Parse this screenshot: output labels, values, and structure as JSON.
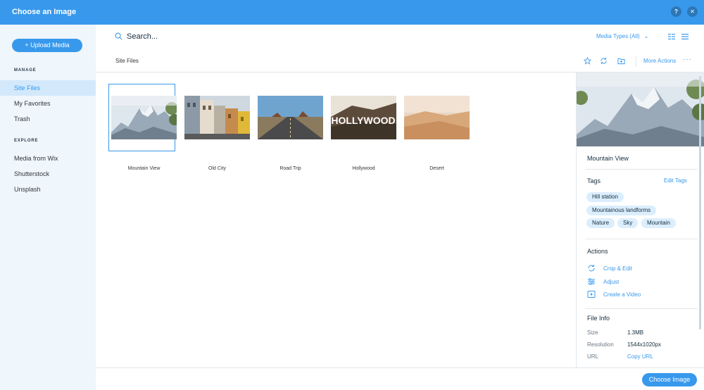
{
  "window": {
    "title": "Choose an Image",
    "help_label": "?",
    "close_label": "✕"
  },
  "sidebar": {
    "upload_label": "+ Upload Media",
    "manage_heading": "MANAGE",
    "manage_items": [
      {
        "label": "Site Files",
        "active": true
      },
      {
        "label": "My Favorites"
      },
      {
        "label": "Trash"
      }
    ],
    "explore_heading": "EXPLORE",
    "explore_items": [
      {
        "label": "Media from Wix"
      },
      {
        "label": "Shutterstock"
      },
      {
        "label": "Unsplash"
      }
    ]
  },
  "search": {
    "text": "Search...",
    "icon": "search-icon"
  },
  "filters": {
    "media_types": "Media Types (All)",
    "chevron": "⌄"
  },
  "toolbar": {
    "breadcrumb": "Site Files",
    "more_actions": "More Actions",
    "more_dots": "···"
  },
  "grid": {
    "items": [
      {
        "caption": "Mountain View",
        "selected": true
      },
      {
        "caption": "Old City"
      },
      {
        "caption": "Road Trip"
      },
      {
        "caption": "Hollywood"
      },
      {
        "caption": "Desert"
      }
    ],
    "hollywood_sign_text": "HOLLYWOOD"
  },
  "details": {
    "name": "Mountain View",
    "tags_title": "Tags",
    "edit_tags": "Edit Tags",
    "tags": [
      "Hill station",
      "Mountainous landforms",
      "Nature",
      "Sky",
      "Mountain"
    ],
    "actions_title": "Actions",
    "actions": [
      {
        "label": "Crop & Edit",
        "icon": "crop-icon"
      },
      {
        "label": "Adjust",
        "icon": "adjust-icon"
      },
      {
        "label": "Create a Video",
        "icon": "video-icon"
      }
    ],
    "file_info_title": "File Info",
    "file_info": [
      {
        "key": "Size",
        "value": "1.3MB"
      },
      {
        "key": "Resolution",
        "value": "1544x1020px"
      },
      {
        "key": "URL",
        "value": "Copy URL",
        "link": true
      }
    ]
  },
  "footer": {
    "choose_label": "Choose Image"
  },
  "colors": {
    "accent": "#3899ec",
    "sidebar_bg": "#eff6fc",
    "tag_bg": "#dbeefd"
  }
}
